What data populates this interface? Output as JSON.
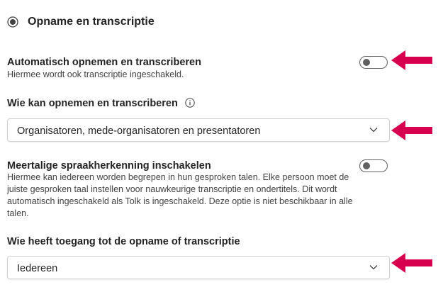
{
  "section": {
    "title": "Opname en transcriptie",
    "icon": "radio-selected-icon"
  },
  "auto_record": {
    "title": "Automatisch opnemen en transcriberen",
    "description": "Hiermee wordt ook transcriptie ingeschakeld.",
    "toggle_on": false
  },
  "who_can_record": {
    "title": "Wie kan opnemen en transcriberen",
    "info_icon": "info-icon",
    "selected": "Organisatoren, mede-organisatoren en presentatoren"
  },
  "multilingual": {
    "title": "Meertalige spraakherkenning inschakelen",
    "description_lines": [
      "Hiermee kan iedereen worden begrepen in hun gesproken talen. Elke persoon moet de",
      "juiste gesproken taal instellen voor nauwkeurige transcriptie en ondertitels. Dit wordt",
      "automatisch ingeschakeld als Tolk is ingeschakeld. Deze optie is niet beschikbaar in alle",
      "talen."
    ],
    "toggle_on": false
  },
  "who_has_access": {
    "title": "Wie heeft toegang tot de opname of transcriptie",
    "selected": "Iedereen"
  },
  "colors": {
    "arrow": "#d6004f",
    "toggle_off": "#616161",
    "border": "#d1d1d1"
  }
}
